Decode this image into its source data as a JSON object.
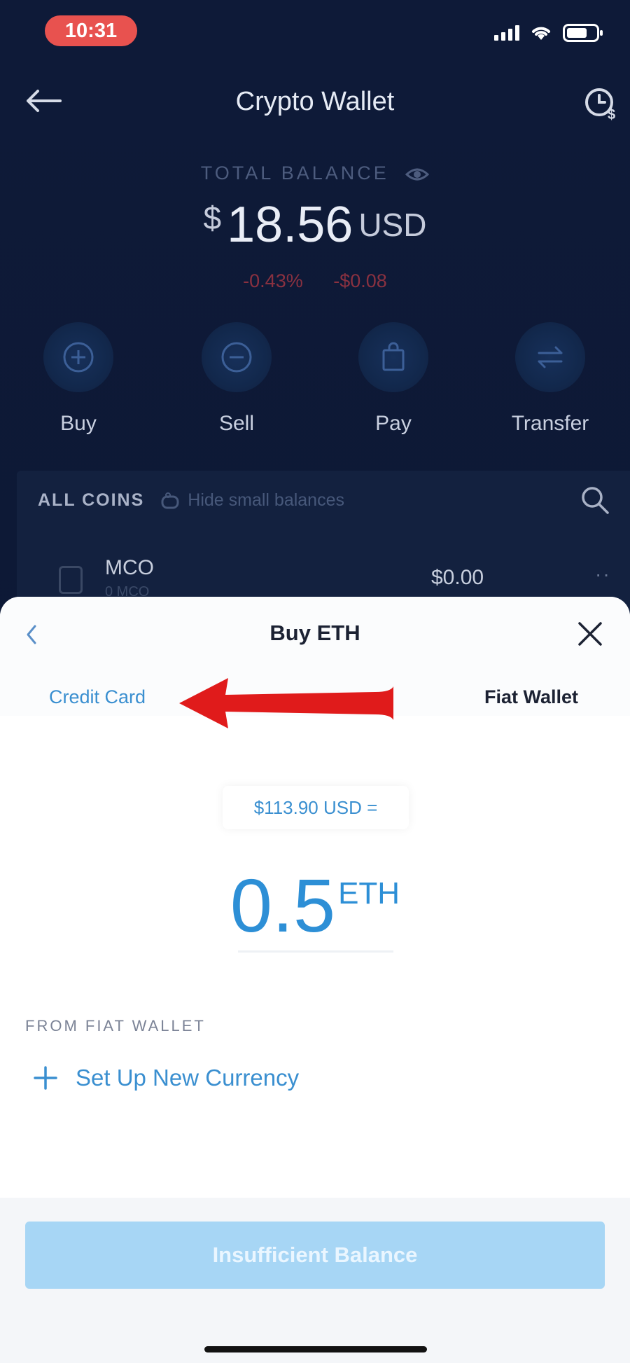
{
  "status_bar": {
    "time": "10:31"
  },
  "nav": {
    "title": "Crypto Wallet"
  },
  "balance": {
    "label": "TOTAL BALANCE",
    "currency_symbol": "$",
    "amount": "18.56",
    "unit": "USD",
    "change_percent": "-0.43%",
    "change_value": "-$0.08"
  },
  "actions": [
    {
      "label": "Buy",
      "icon": "plus-circle-icon"
    },
    {
      "label": "Sell",
      "icon": "minus-circle-icon"
    },
    {
      "label": "Pay",
      "icon": "shopping-bag-icon"
    },
    {
      "label": "Transfer",
      "icon": "transfer-arrows-icon"
    }
  ],
  "coins": {
    "header": "ALL COINS",
    "hide_small": "Hide small balances",
    "rows": [
      {
        "symbol": "MCO",
        "sub": "0 MCO",
        "value": "$0.00",
        "more": "··"
      }
    ]
  },
  "sheet": {
    "title": "Buy ETH",
    "tab_credit": "Credit Card",
    "tab_fiat": "Fiat Wallet",
    "quote": "$113.90 USD =",
    "amount": "0.5",
    "token": "ETH",
    "from_label": "FROM FIAT WALLET",
    "setup_label": "Set Up New Currency",
    "cta_label": "Insufficient Balance"
  },
  "colors": {
    "accent_blue": "#3a8fd0",
    "annotation_arrow_red": "#e01b1b",
    "negative_change": "#8a3140",
    "cta_disabled": "#a7d6f5"
  }
}
